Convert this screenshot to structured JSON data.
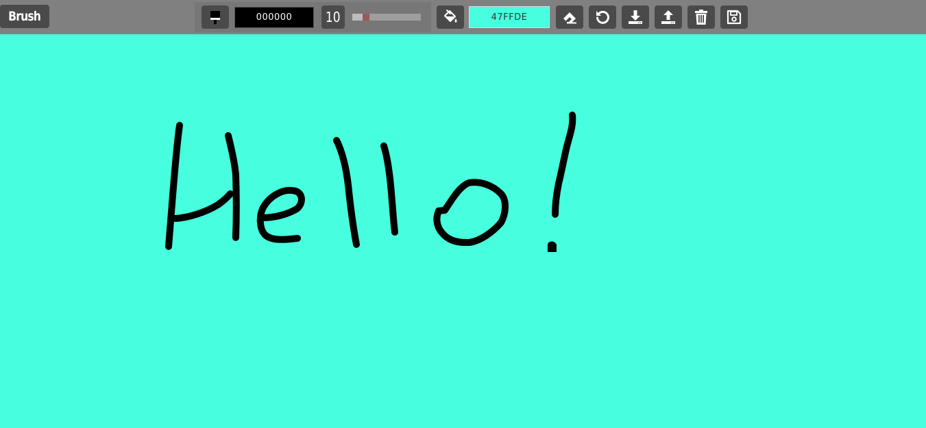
{
  "toolbar": {
    "mode_label": "Brush",
    "brush_color_value": "000000",
    "brush_size_value": "10",
    "brush_size_slider": {
      "min": 1,
      "max": 100,
      "value": 18
    },
    "background_color_value": "47FFDE"
  },
  "icons": {
    "brush": "brush-icon",
    "fill": "paint-bucket-icon",
    "eraser": "eraser-icon",
    "undo": "undo-icon",
    "download": "download-icon",
    "upload": "upload-icon",
    "clear": "trash-icon",
    "save": "save-icon"
  },
  "colors": {
    "canvas_background": "#47FFDE",
    "brush_color": "#000000",
    "toolbar_background": "#808080",
    "button_background": "#4a4a4a"
  },
  "canvas": {
    "drawing": "handwritten-text",
    "stroke_color": "#000000",
    "stroke_width": 10
  }
}
